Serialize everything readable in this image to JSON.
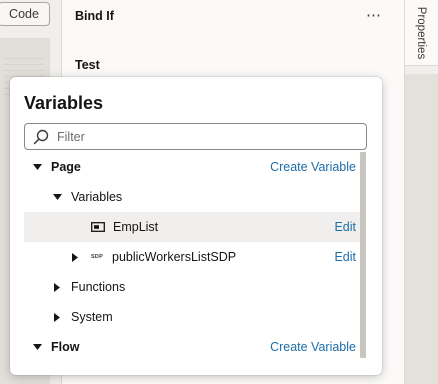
{
  "toolbar": {
    "code_label": "Code"
  },
  "properties": {
    "heading": "Bind If",
    "more_icon": "⋯",
    "section_label": "Test",
    "tab_label": "Properties"
  },
  "popup": {
    "title": "Variables",
    "filter_placeholder": "Filter",
    "filter_value": "",
    "tree": {
      "page": {
        "label": "Page",
        "action": "Create Variable"
      },
      "variables": {
        "label": "Variables"
      },
      "emplist": {
        "label": "EmpList",
        "action": "Edit",
        "icon": "array-type-icon"
      },
      "sdp": {
        "type_tag": "SDP",
        "label": "publicWorkersListSDP",
        "action": "Edit"
      },
      "functions": {
        "label": "Functions"
      },
      "system": {
        "label": "System"
      },
      "flow": {
        "label": "Flow",
        "action": "Create Variable"
      }
    }
  },
  "colors": {
    "link": "#1e6ea7",
    "selected_row": "#f1efed",
    "text": "#161513"
  }
}
